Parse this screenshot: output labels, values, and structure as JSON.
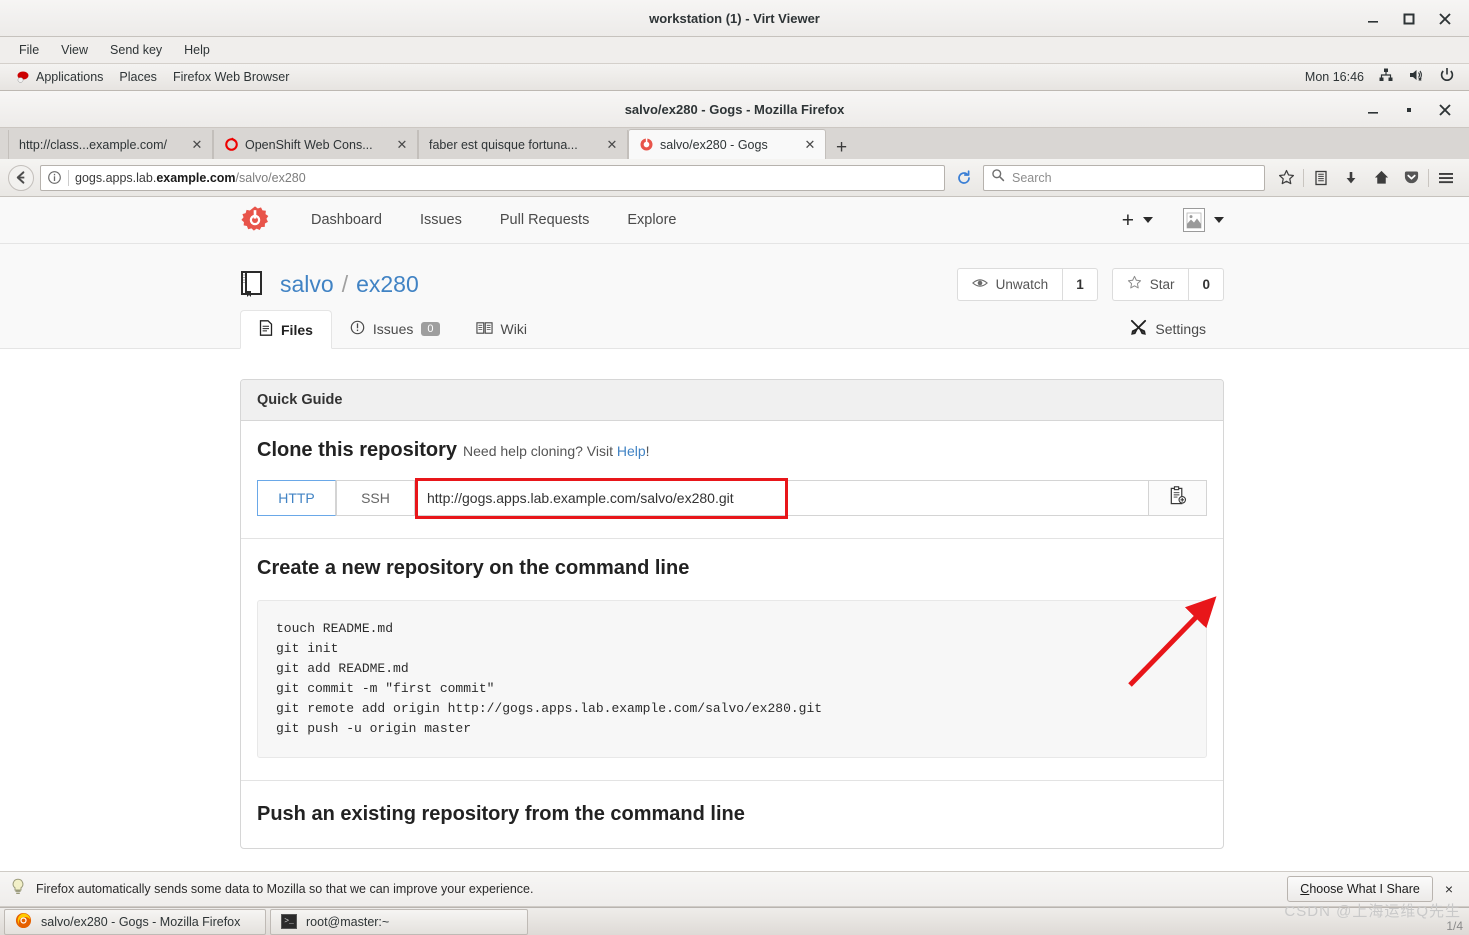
{
  "virt_viewer": {
    "title": "workstation (1) - Virt Viewer",
    "menu": [
      "File",
      "View",
      "Send key",
      "Help"
    ],
    "window_buttons": [
      "minimize",
      "maximize",
      "close"
    ]
  },
  "gnome_panel": {
    "items": [
      "Applications",
      "Places",
      "Firefox Web Browser"
    ],
    "clock": "Mon 16:46",
    "tray_icons": [
      "network-icon",
      "volume-muted-icon",
      "power-icon"
    ]
  },
  "firefox": {
    "title": "salvo/ex280 - Gogs - Mozilla Firefox",
    "tabs": [
      {
        "label": "http://class...example.com/",
        "favicon": "none",
        "active": false
      },
      {
        "label": "OpenShift Web Cons...",
        "favicon": "openshift",
        "active": false
      },
      {
        "label": "faber est quisque fortuna...",
        "favicon": "none",
        "active": false
      },
      {
        "label": "salvo/ex280 - Gogs",
        "favicon": "gogs",
        "active": true
      }
    ],
    "new_tab_label": "+",
    "url": {
      "prefix": "gogs.apps.lab.",
      "domain": "example.com",
      "path": "/salvo/ex280"
    },
    "search_placeholder": "Search",
    "toolbar_icons": [
      "star-icon",
      "library-icon",
      "download-icon",
      "home-icon",
      "pocket-icon",
      "menu-icon"
    ],
    "notification": {
      "text": "Firefox automatically sends some data to Mozilla so that we can improve your experience.",
      "button": "Choose What I Share",
      "button_accesskey": "C",
      "close": "×"
    }
  },
  "gogs": {
    "nav_links": [
      "Dashboard",
      "Issues",
      "Pull Requests",
      "Explore"
    ],
    "plus_label": "+",
    "repo": {
      "owner": "salvo",
      "separator": "/",
      "name": "ex280",
      "watch_label": "Unwatch",
      "watch_count": "1",
      "star_label": "Star",
      "star_count": "0"
    },
    "tabs": [
      {
        "label": "Files",
        "icon": "file-icon",
        "badge": null,
        "active": true
      },
      {
        "label": "Issues",
        "icon": "issue-icon",
        "badge": "0",
        "active": false
      },
      {
        "label": "Wiki",
        "icon": "book-icon",
        "badge": null,
        "active": false
      }
    ],
    "settings_label": "Settings",
    "quick_guide": {
      "panel_title": "Quick Guide",
      "clone_title": "Clone this repository",
      "clone_subtitle_pre": "Need help cloning? Visit ",
      "clone_help_link": "Help",
      "clone_subtitle_post": "!",
      "protocol_http": "HTTP",
      "protocol_ssh": "SSH",
      "clone_url": "http://gogs.apps.lab.example.com/salvo/ex280.git",
      "copy_icon": "clipboard-copy-icon",
      "create_title": "Create a new repository on the command line",
      "create_commands": "touch README.md\ngit init\ngit add README.md\ngit commit -m \"first commit\"\ngit remote add origin http://gogs.apps.lab.example.com/salvo/ex280.git\ngit push -u origin master",
      "push_title": "Push an existing repository from the command line"
    }
  },
  "taskbar": {
    "items": [
      {
        "label": "salvo/ex280 - Gogs - Mozilla Firefox",
        "icon": "firefox-icon"
      },
      {
        "label": "root@master:~",
        "icon": "terminal-icon"
      }
    ]
  },
  "annotations": {
    "watermark": "CSDN @上海运维Q先生",
    "page_indicator": "1/4",
    "highlight_color": "#e8161a"
  }
}
